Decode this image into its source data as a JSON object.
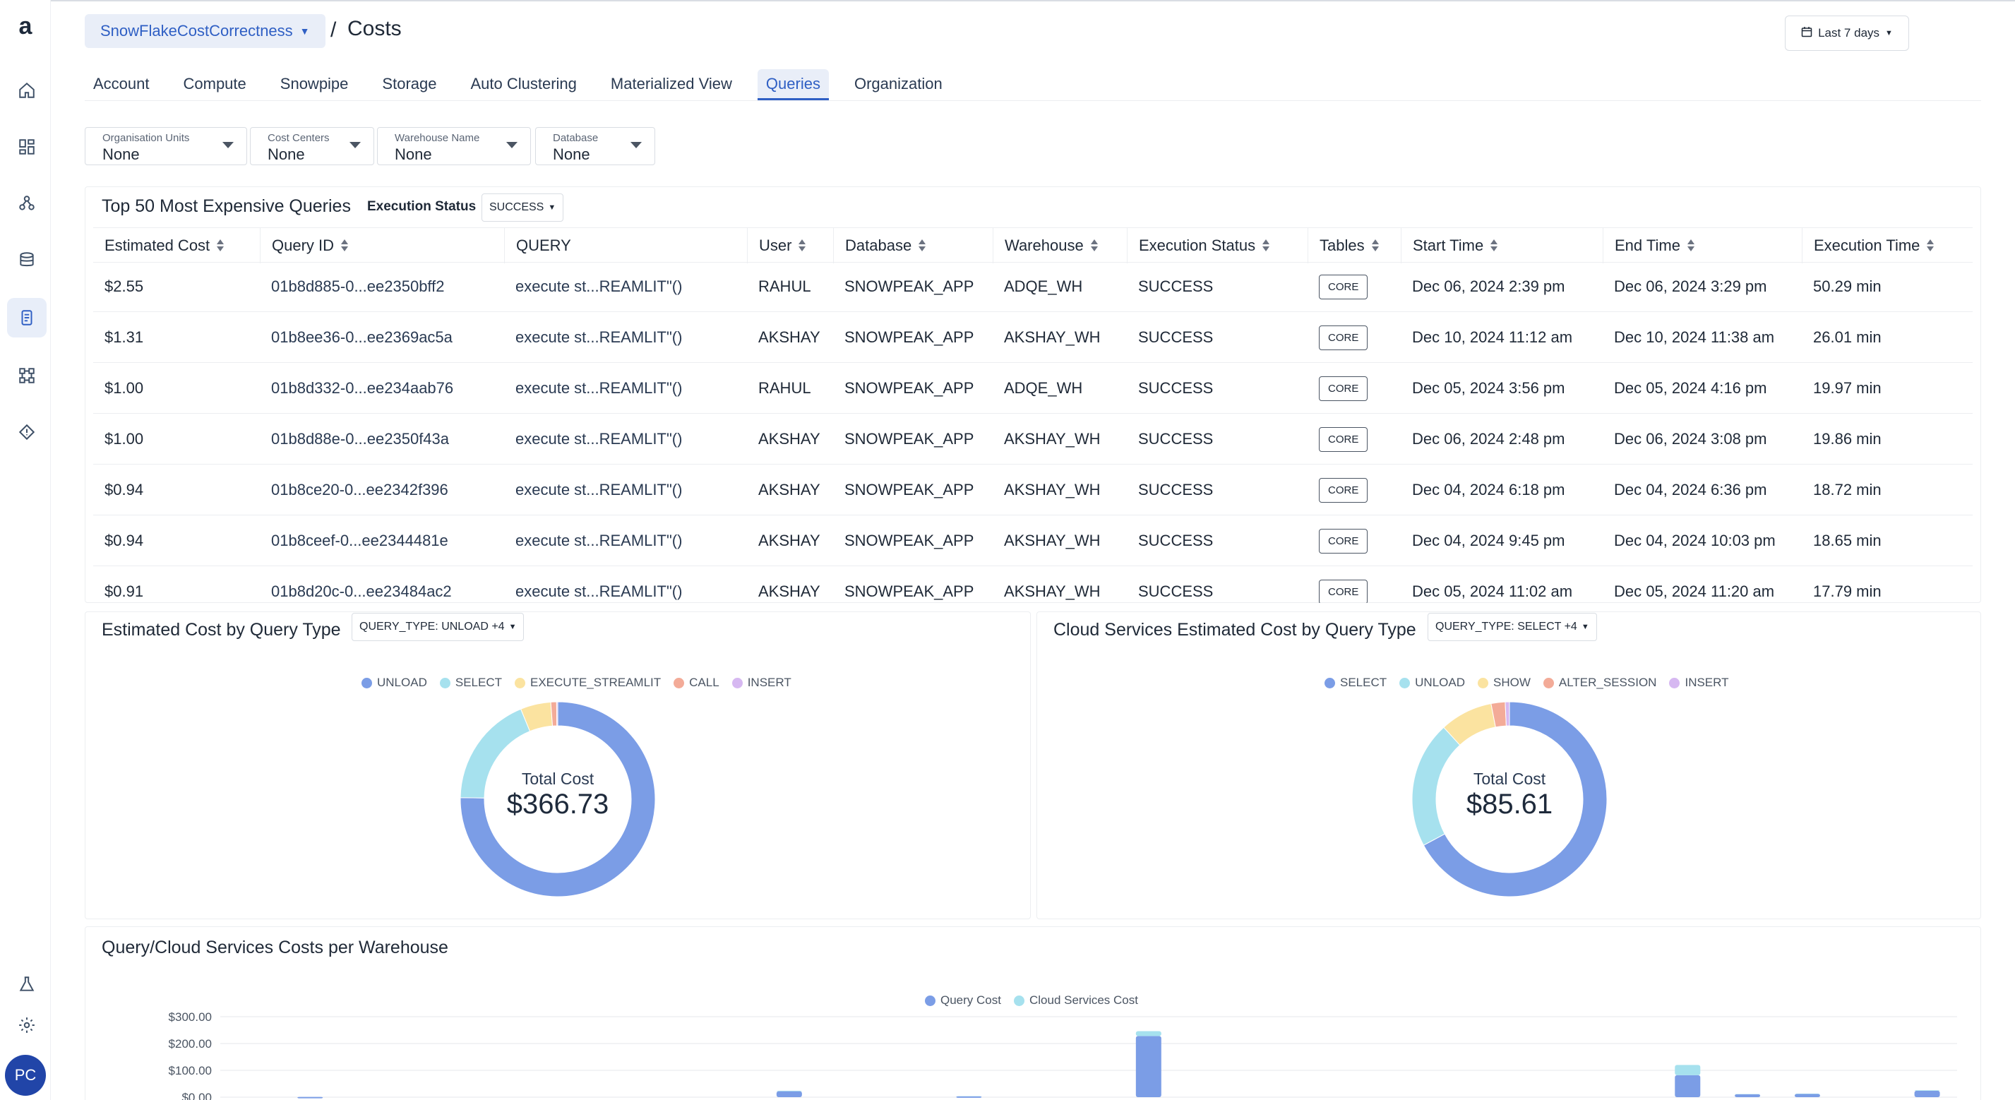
{
  "app": {
    "logo": "a",
    "breadcrumb": "SnowFlakeCostCorrectness",
    "separator": "/",
    "title": "Costs",
    "date_range": "Last 7 days",
    "avatar_initials": "PC"
  },
  "sidebar": {
    "icons": [
      "home-icon",
      "dashboard-icon",
      "data-graph-icon",
      "database-icon",
      "cost-icon",
      "pipeline-icon",
      "diamond-icon",
      "flask-icon",
      "settings-icon"
    ]
  },
  "tabs": [
    {
      "label": "Account",
      "active": false
    },
    {
      "label": "Compute",
      "active": false
    },
    {
      "label": "Snowpipe",
      "active": false
    },
    {
      "label": "Storage",
      "active": false
    },
    {
      "label": "Auto Clustering",
      "active": false
    },
    {
      "label": "Materialized View",
      "active": false
    },
    {
      "label": "Queries",
      "active": true
    },
    {
      "label": "Organization",
      "active": false
    }
  ],
  "filters": [
    {
      "label": "Organisation Units",
      "value": "None"
    },
    {
      "label": "Cost Centers",
      "value": "None"
    },
    {
      "label": "Warehouse Name",
      "value": "None"
    },
    {
      "label": "Database",
      "value": "None"
    }
  ],
  "top_queries": {
    "title": "Top 50 Most Expensive Queries",
    "status_label": "Execution Status",
    "status_value": "SUCCESS",
    "columns": [
      "Estimated Cost",
      "Query ID",
      "QUERY",
      "User",
      "Database",
      "Warehouse",
      "Execution Status",
      "Tables",
      "Start Time",
      "End Time",
      "Execution Time"
    ],
    "rows": [
      [
        "$2.55",
        "01b8d885-0...ee2350bff2",
        "execute st...REAMLIT\"()",
        "RAHUL",
        "SNOWPEAK_APP",
        "ADQE_WH",
        "SUCCESS",
        "CORE",
        "Dec 06, 2024 2:39 pm",
        "Dec 06, 2024 3:29 pm",
        "50.29 min"
      ],
      [
        "$1.31",
        "01b8ee36-0...ee2369ac5a",
        "execute st...REAMLIT\"()",
        "AKSHAY",
        "SNOWPEAK_APP",
        "AKSHAY_WH",
        "SUCCESS",
        "CORE",
        "Dec 10, 2024 11:12 am",
        "Dec 10, 2024 11:38 am",
        "26.01 min"
      ],
      [
        "$1.00",
        "01b8d332-0...ee234aab76",
        "execute st...REAMLIT\"()",
        "RAHUL",
        "SNOWPEAK_APP",
        "ADQE_WH",
        "SUCCESS",
        "CORE",
        "Dec 05, 2024 3:56 pm",
        "Dec 05, 2024 4:16 pm",
        "19.97 min"
      ],
      [
        "$1.00",
        "01b8d88e-0...ee2350f43a",
        "execute st...REAMLIT\"()",
        "AKSHAY",
        "SNOWPEAK_APP",
        "AKSHAY_WH",
        "SUCCESS",
        "CORE",
        "Dec 06, 2024 2:48 pm",
        "Dec 06, 2024 3:08 pm",
        "19.86 min"
      ],
      [
        "$0.94",
        "01b8ce20-0...ee2342f396",
        "execute st...REAMLIT\"()",
        "AKSHAY",
        "SNOWPEAK_APP",
        "AKSHAY_WH",
        "SUCCESS",
        "CORE",
        "Dec 04, 2024 6:18 pm",
        "Dec 04, 2024 6:36 pm",
        "18.72 min"
      ],
      [
        "$0.94",
        "01b8ceef-0...ee2344481e",
        "execute st...REAMLIT\"()",
        "AKSHAY",
        "SNOWPEAK_APP",
        "AKSHAY_WH",
        "SUCCESS",
        "CORE",
        "Dec 04, 2024 9:45 pm",
        "Dec 04, 2024 10:03 pm",
        "18.65 min"
      ],
      [
        "$0.91",
        "01b8d20c-0...ee23484ac2",
        "execute st...REAMLIT\"()",
        "AKSHAY",
        "SNOWPEAK_APP",
        "AKSHAY_WH",
        "SUCCESS",
        "CORE",
        "Dec 05, 2024 11:02 am",
        "Dec 05, 2024 11:20 am",
        "17.79 min"
      ]
    ]
  },
  "query_type_card": {
    "title": "Estimated Cost by Query Type",
    "select": "QUERY_TYPE: UNLOAD +4",
    "center_label": "Total Cost",
    "center_value": "$366.73"
  },
  "cloud_card": {
    "title": "Cloud Services Estimated Cost by Query Type",
    "select": "QUERY_TYPE: SELECT +4",
    "center_label": "Total Cost",
    "center_value": "$85.61"
  },
  "warehouse_card": {
    "title": "Query/Cloud Services Costs per Warehouse"
  },
  "colors": {
    "accent": "#2f5fc4",
    "blue": "#7b9de6",
    "cyan": "#a6e1ee",
    "yellow": "#fbe3a0",
    "salmon": "#f3ab98",
    "lavender": "#d6b8f1"
  },
  "chart_data": [
    {
      "type": "pie",
      "title": "Estimated Cost by Query Type",
      "categories": [
        "UNLOAD",
        "SELECT",
        "EXECUTE_STREAMLIT",
        "CALL",
        "INSERT"
      ],
      "values": [
        276.0,
        68.0,
        18.5,
        3.5,
        0.7
      ],
      "colors": [
        "#7b9de6",
        "#a6e1ee",
        "#fbe3a0",
        "#f3ab98",
        "#d6b8f1"
      ],
      "legend": "top"
    },
    {
      "type": "pie",
      "title": "Cloud Services Estimated Cost by Query Type",
      "categories": [
        "SELECT",
        "UNLOAD",
        "SHOW",
        "ALTER_SESSION",
        "INSERT"
      ],
      "values": [
        57.5,
        18.0,
        7.5,
        2.0,
        0.6
      ],
      "colors": [
        "#7b9de6",
        "#a6e1ee",
        "#fbe3a0",
        "#f3ab98",
        "#d6b8f1"
      ],
      "legend": "top"
    },
    {
      "type": "bar",
      "title": "Query/Cloud Services Costs per Warehouse",
      "stacked": true,
      "ylim": [
        0,
        300
      ],
      "yticks": [
        "$300.00",
        "$200.00",
        "$100.00",
        "$0.00"
      ],
      "ytick_values": [
        300,
        200,
        100,
        0
      ],
      "categories": [
        "",
        "",
        "",
        "",
        "",
        "",
        "",
        "",
        "",
        "",
        "",
        "",
        "",
        "",
        "",
        "",
        "",
        "",
        "",
        "",
        "",
        "",
        "",
        "",
        "",
        "",
        "",
        "",
        ""
      ],
      "series": [
        {
          "name": "Query Cost",
          "color": "#7b9de6",
          "values": [
            0,
            1,
            0,
            0,
            0,
            0,
            0,
            0,
            0,
            22,
            0,
            0,
            3,
            0,
            0,
            228,
            0,
            0,
            0,
            0,
            0,
            0,
            0,
            0,
            82,
            11,
            12,
            0,
            24
          ]
        },
        {
          "name": "Cloud Services Cost",
          "color": "#a6e1ee",
          "values": [
            0,
            0,
            0,
            0,
            0,
            0,
            0,
            0,
            0,
            2,
            0,
            0,
            1,
            0,
            0,
            18,
            0,
            0,
            0,
            0,
            0,
            0,
            0,
            0,
            38,
            1,
            1,
            0,
            2
          ]
        }
      ],
      "legend": "top"
    }
  ]
}
